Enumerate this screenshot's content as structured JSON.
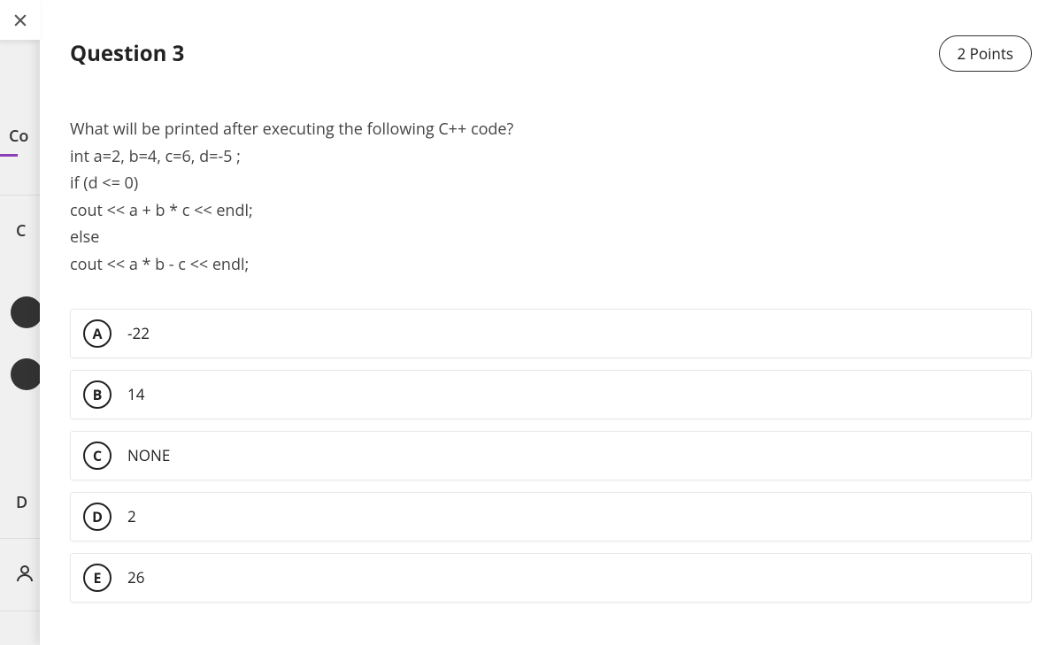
{
  "header": {
    "question_label": "Question 3",
    "points_label": "2 Points"
  },
  "question": {
    "prompt": "What will be printed after executing the following C++ code?",
    "code_lines": [
      "int a=2, b=4, c=6, d=-5 ;",
      "if (d <= 0)",
      "cout << a + b * c << endl;",
      "else",
      "cout << a * b - c << endl;"
    ]
  },
  "options": [
    {
      "letter": "A",
      "text": "-22"
    },
    {
      "letter": "B",
      "text": "14"
    },
    {
      "letter": "C",
      "text": "NONE"
    },
    {
      "letter": "D",
      "text": "2"
    },
    {
      "letter": "E",
      "text": "26"
    }
  ],
  "background": {
    "cc": "Co",
    "c": "C",
    "d": "D"
  }
}
